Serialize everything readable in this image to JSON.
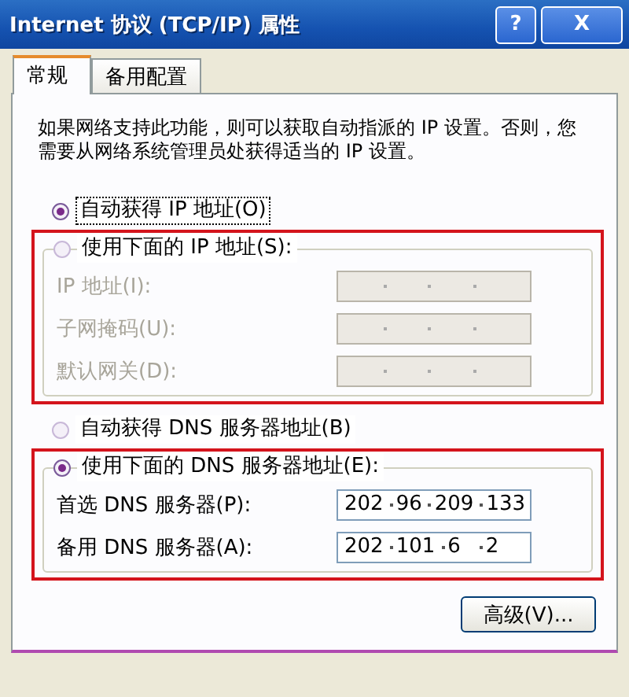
{
  "window": {
    "title": "Internet 协议 (TCP/IP) 属性"
  },
  "title_buttons": [
    {
      "kind": "help",
      "label": "?"
    },
    {
      "kind": "close",
      "label": "X"
    }
  ],
  "tabs": [
    {
      "label": "常规",
      "selected": true
    },
    {
      "label": "备用配置",
      "selected": false
    }
  ],
  "description": "如果网络支持此功能，则可以获取自动指派的 IP 设置。否则，您需要从网络系统管理员处获得适当的 IP 设置。",
  "sections": [
    {
      "auto": {
        "label": "自动获得 IP 地址(O)",
        "selected": true,
        "focused": true
      },
      "manual": {
        "label": "使用下面的 IP 地址(S):",
        "selected": false,
        "highlighted": true,
        "fields": [
          {
            "label": "IP 地址(I):",
            "disabled": true
          },
          {
            "label": "子网掩码(U):",
            "disabled": true
          },
          {
            "label": "默认网关(D):",
            "disabled": true
          }
        ]
      }
    },
    {
      "auto": {
        "label": "自动获得 DNS 服务器地址(B)",
        "selected": false,
        "focused": false
      },
      "manual": {
        "label": "使用下面的 DNS 服务器地址(E):",
        "selected": true,
        "highlighted": true,
        "fields": [
          {
            "label": "首选 DNS 服务器(P):",
            "disabled": false,
            "octets": [
              "202",
              "96",
              "209",
              "133"
            ]
          },
          {
            "label": "备用 DNS 服务器(A):",
            "disabled": false,
            "octets": [
              "202",
              "101",
              "6",
              "2"
            ]
          }
        ]
      }
    }
  ],
  "buttons": [
    {
      "label": "高级(V)..."
    }
  ]
}
